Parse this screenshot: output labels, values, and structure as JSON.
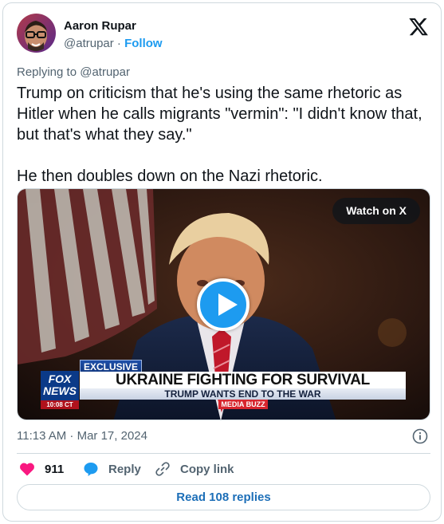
{
  "author": {
    "name": "Aaron Rupar",
    "handle": "@atrupar",
    "separator": " · ",
    "follow_label": "Follow"
  },
  "replying_to": "Replying to @atrupar",
  "tweet": {
    "paragraph1": "Trump on criticism that he's using the same rhetoric as Hitler when he calls migrants \"vermin\": \"I didn't know that, but that's what they say.\"",
    "paragraph2": "He then doubles down on the Nazi rhetoric."
  },
  "media": {
    "watch_label": "Watch on X",
    "chyron": {
      "tag": "EXCLUSIVE",
      "headline": "UKRAINE FIGHTING FOR SURVIVAL",
      "subhead": "TRUMP WANTS END TO THE WAR",
      "brand": "MEDIA BUZZ",
      "network_line1": "FOX",
      "network_line2": "NEWS",
      "clock": "10:08 CT"
    }
  },
  "timestamp": "11:13 AM · Mar 17, 2024",
  "actions": {
    "like_count": "911",
    "reply_label": "Reply",
    "copy_label": "Copy link"
  },
  "read_replies_label": "Read 108 replies",
  "colors": {
    "accent": "#1d9bf0",
    "like": "#f91880",
    "secondary_text": "#536471",
    "border": "#cfd9de"
  },
  "icons": [
    "x-logo-icon",
    "info-icon",
    "heart-icon",
    "reply-bubble-icon",
    "link-icon",
    "play-icon"
  ]
}
